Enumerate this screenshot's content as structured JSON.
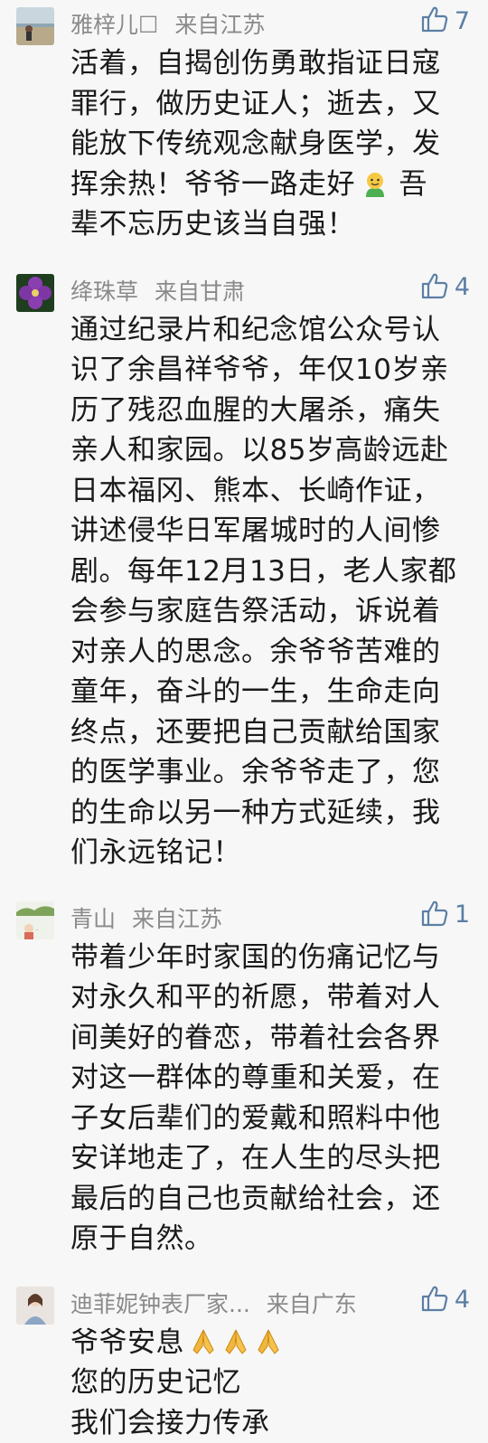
{
  "comments": [
    {
      "name": "雅梓儿☐",
      "location": "来自江苏",
      "likes": "7",
      "lines": [
        "活着，自揭创伤勇敢指证日寇",
        "罪行，做历史证人；逝去，又",
        "能放下传统观念献身医学，发",
        "挥余热！爷爷一路走好",
        "辈不忘历史该当自强！"
      ],
      "line4_tail": " 吾"
    },
    {
      "name": "绛珠草",
      "location": "来自甘肃",
      "likes": "4",
      "lines": [
        "通过纪录片和纪念馆公众号认",
        "识了余昌祥爷爷，年仅10岁亲",
        "历了残忍血腥的大屠杀，痛失",
        "亲人和家园。以85岁高龄远赴",
        "日本福冈、熊本、长崎作证，",
        "讲述侵华日军屠城时的人间惨",
        "剧。每年12月13日，老人家都",
        "会参与家庭告祭活动，诉说着",
        "对亲人的思念。余爷爷苦难的",
        "童年，奋斗的一生，生命走向",
        "终点，还要把自己贡献给国家",
        "的医学事业。余爷爷走了，您",
        "的生命以另一种方式延续，我",
        "们永远铭记！"
      ]
    },
    {
      "name": "青山",
      "location": "来自江苏",
      "likes": "1",
      "lines": [
        "带着少年时家国的伤痛记忆与",
        "对永久和平的祈愿，带着对人",
        "间美好的眷恋，带着社会各界",
        "对这一群体的尊重和关爱，在",
        "子女后辈们的爱戴和照料中他",
        "安详地走了，在人生的尽头把",
        "最后的自己也贡献给社会，还",
        "原于自然。"
      ]
    },
    {
      "name": "迪菲妮钟表厂家...",
      "location": "来自广东",
      "likes": "4",
      "lines": [
        "爷爷安息",
        "您的历史记忆",
        "我们会接力传承"
      ]
    }
  ],
  "icons": {
    "like": "thumbs-up-icon",
    "smile": "smiling-face-emoji",
    "pray": "folded-hands-emoji"
  },
  "colors": {
    "name": "#8a8a8a",
    "like": "#5b7fa5",
    "text": "#1a1a1a",
    "background": "#f7f7f7"
  }
}
